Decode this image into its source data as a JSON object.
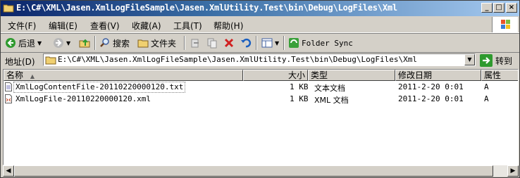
{
  "window": {
    "title": "E:\\C#\\XML\\Jasen.XmlLogFileSample\\Jasen.XmlUtility.Test\\bin\\Debug\\LogFiles\\Xml",
    "min_label": "_",
    "max_label": "□",
    "close_label": "×"
  },
  "menu": [
    {
      "label": "文件(F)"
    },
    {
      "label": "编辑(E)"
    },
    {
      "label": "查看(V)"
    },
    {
      "label": "收藏(A)"
    },
    {
      "label": "工具(T)"
    },
    {
      "label": "帮助(H)"
    }
  ],
  "toolbar": {
    "back_label": "后退",
    "search_label": "搜索",
    "folders_label": "文件夹",
    "folder_sync_label": "Folder Sync"
  },
  "address": {
    "label": "地址(D)",
    "value": "E:\\C#\\XML\\Jasen.XmlLogFileSample\\Jasen.XmlUtility.Test\\bin\\Debug\\LogFiles\\Xml",
    "go_label": "转到"
  },
  "columns": {
    "name": "名称",
    "size": "大小",
    "type": "类型",
    "modified": "修改日期",
    "attributes": "属性"
  },
  "files": [
    {
      "name": "XmlLogContentFile-20110220000120.txt",
      "size": "1 KB",
      "type": "文本文档",
      "modified": "2011-2-20 0:01",
      "attr": "A"
    },
    {
      "name": "XmlLogFile-20110220000120.xml",
      "size": "1 KB",
      "type": "XML 文档",
      "modified": "2011-2-20 0:01",
      "attr": "A"
    }
  ],
  "colors": {
    "title_start": "#0a246a",
    "title_end": "#a6caf0",
    "face": "#d4d0c8"
  }
}
